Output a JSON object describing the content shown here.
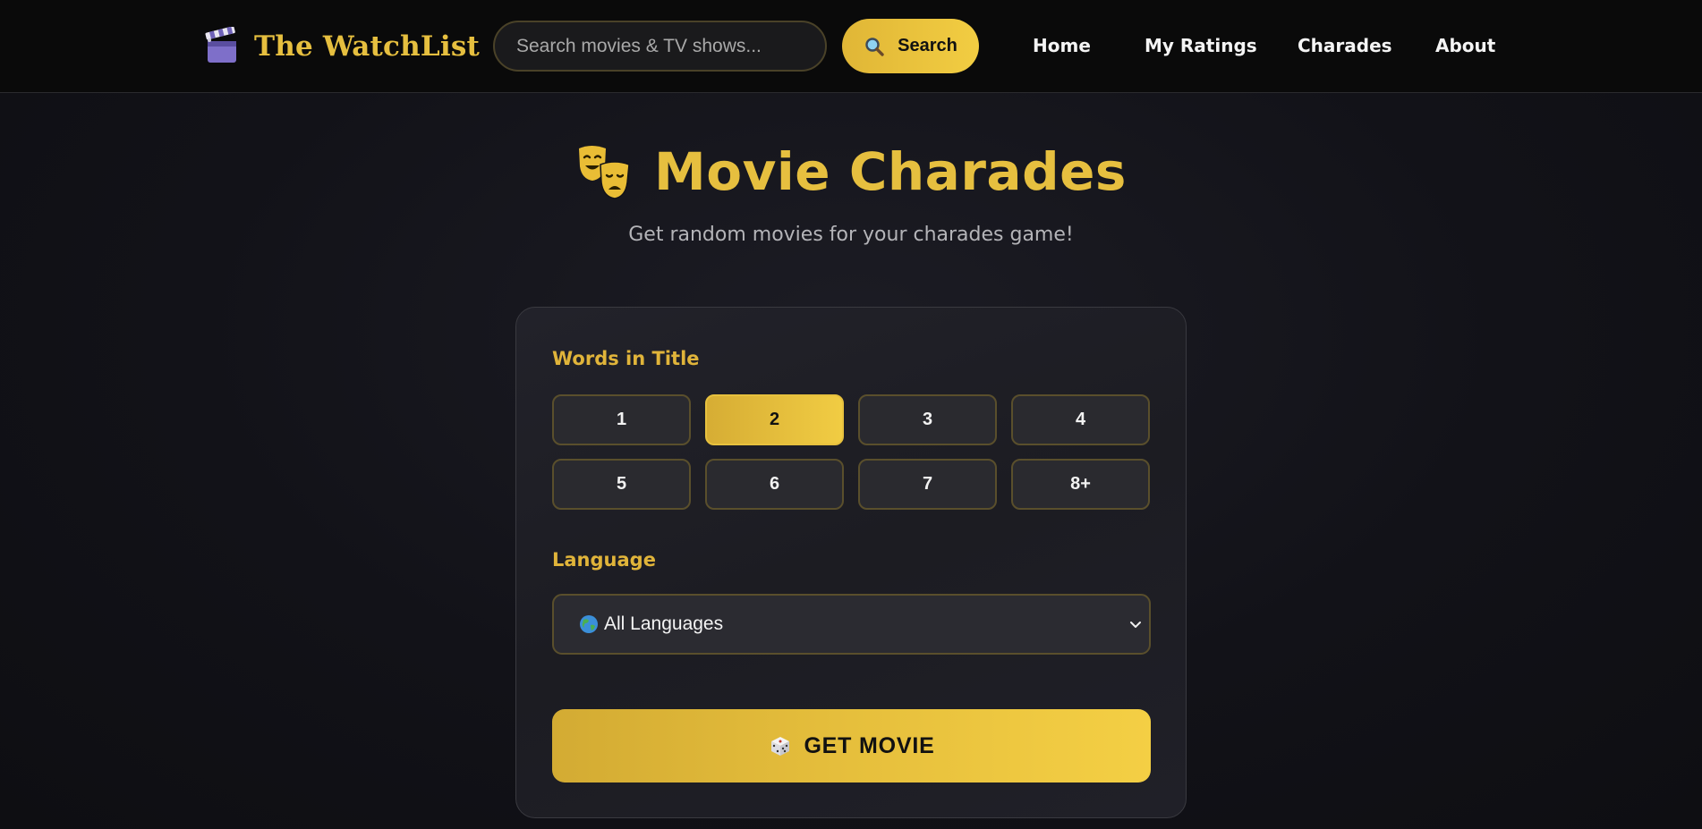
{
  "header": {
    "brand_name": "The WatchList",
    "brand_icon": "clapperboard-icon",
    "search_placeholder": "Search movies & TV shows...",
    "search_value": "",
    "search_button_label": "Search",
    "search_button_icon": "magnifier-icon",
    "nav": [
      {
        "label": "Home"
      },
      {
        "label": "My Ratings"
      },
      {
        "label": "Charades"
      },
      {
        "label": "About"
      }
    ]
  },
  "hero": {
    "icon": "theater-masks-icon",
    "title": "Movie Charades",
    "subtitle": "Get random movies for your charades game!"
  },
  "form": {
    "words_label": "Words in Title",
    "word_options": [
      {
        "label": "1",
        "selected": false
      },
      {
        "label": "2",
        "selected": true
      },
      {
        "label": "3",
        "selected": false
      },
      {
        "label": "4",
        "selected": false
      },
      {
        "label": "5",
        "selected": false
      },
      {
        "label": "6",
        "selected": false
      },
      {
        "label": "7",
        "selected": false
      },
      {
        "label": "8+",
        "selected": false
      }
    ],
    "language_label": "Language",
    "language_icon": "globe-icon",
    "language_selected": "All Languages",
    "get_button_icon": "dice-icon",
    "get_button_label": "GET MOVIE"
  },
  "colors": {
    "accent": "#e6bf3f",
    "header_bg": "#0a0a0a",
    "page_bg": "#121218",
    "card_bg": "#1f1f26",
    "button_text": "#111111"
  }
}
